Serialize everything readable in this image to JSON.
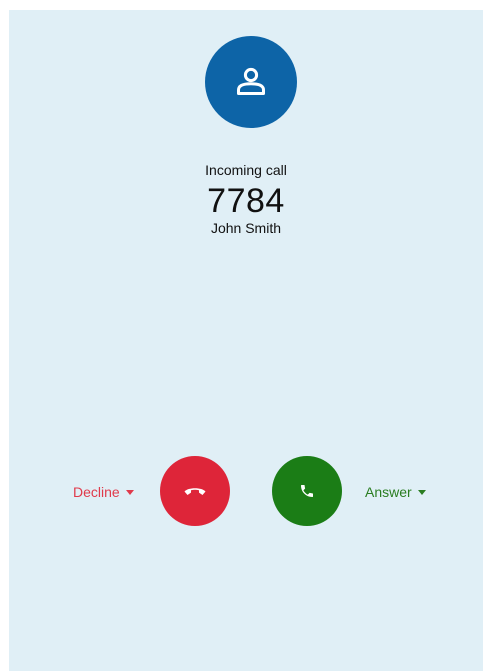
{
  "call": {
    "status": "Incoming call",
    "number": "7784",
    "name": "John Smith"
  },
  "actions": {
    "decline_label": "Decline",
    "answer_label": "Answer"
  },
  "icons": {
    "avatar": "person-icon",
    "decline": "hang-up-phone-icon",
    "answer": "phone-icon",
    "menus": "caret-down-icon"
  },
  "colors": {
    "background": "#e0eff6",
    "avatar": "#0d64a7",
    "decline": "#de2539",
    "answer": "#1b7d16"
  }
}
